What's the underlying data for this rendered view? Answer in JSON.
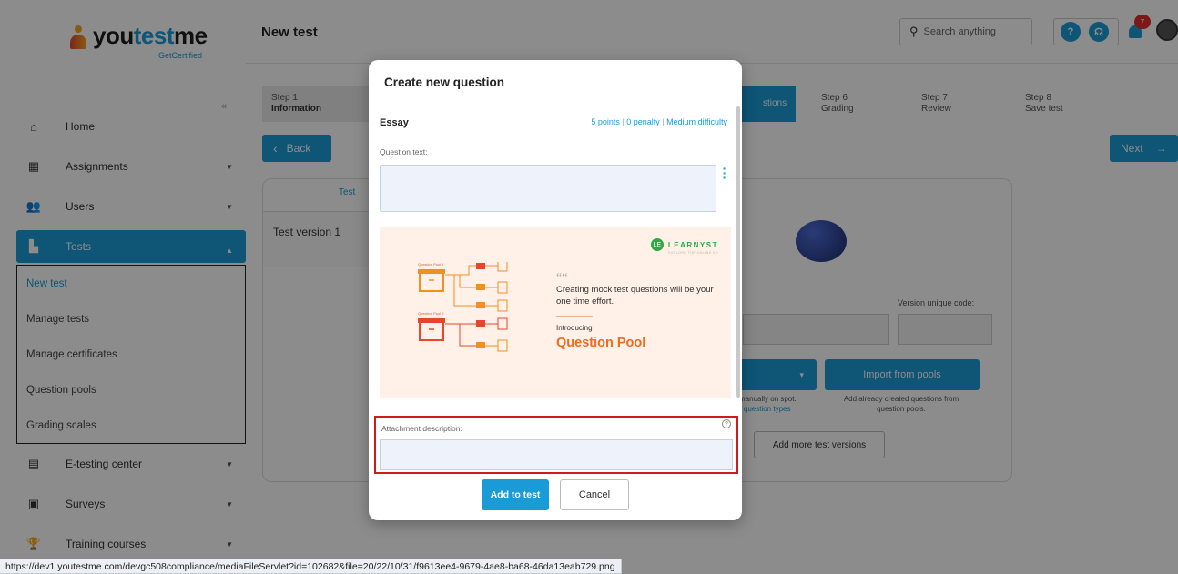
{
  "brand": {
    "name_part1": "you",
    "name_part2": "test",
    "name_part3": "me",
    "tagline": "GetCertified"
  },
  "header": {
    "page_title": "New test",
    "search_placeholder": "Search anything",
    "notifications_count": "7"
  },
  "sidebar": {
    "collapse_icon": "double-chevron-left-icon",
    "items": [
      {
        "label": "Home",
        "icon": "home-icon"
      },
      {
        "label": "Assignments",
        "icon": "assignments-icon"
      },
      {
        "label": "Users",
        "icon": "users-icon"
      },
      {
        "label": "Tests",
        "icon": "tests-icon"
      },
      {
        "label": "E-testing center",
        "icon": "calendar-icon"
      },
      {
        "label": "Surveys",
        "icon": "surveys-icon"
      },
      {
        "label": "Training courses",
        "icon": "trophy-icon"
      }
    ],
    "tests_subitems": [
      "New test",
      "Manage tests",
      "Manage certificates",
      "Question pools",
      "Grading scales"
    ]
  },
  "wizard": {
    "steps": [
      {
        "num": "Step 1",
        "label": "Information"
      },
      {
        "num": "Step 6",
        "label": "Grading"
      },
      {
        "num": "Step 7",
        "label": "Review"
      },
      {
        "num": "Step 8",
        "label": "Save test"
      }
    ],
    "active_step_fragment": "stions",
    "back_label": "Back",
    "next_label": "Next"
  },
  "background_card": {
    "tab_fragment": "Test",
    "version_label": "Test version 1",
    "version_code_label": "Version unique code:",
    "import_label": "Import from pools",
    "manual_help_line1": "manually on spot.",
    "manual_help_link": "r question types",
    "import_help": "Add already created questions from question pools.",
    "add_versions_label": "Add more test versions"
  },
  "modal": {
    "title": "Create new question",
    "question_type": "Essay",
    "points": "5 points",
    "penalty": "0 penalty",
    "difficulty": "Medium difficulty",
    "question_text_label": "Question text:",
    "question_text_value": "",
    "promo": {
      "logo_text": "LEARNYST",
      "logo_tagline": "EXPLORE THE ONLINE ED",
      "quote_mark": "““",
      "quote": "Creating mock test questions will be your one time effort.",
      "intro": "Introducing",
      "headline": "Question Pool",
      "pool_label_1": "Question Pool 1",
      "pool_label_2": "Question Pool 2"
    },
    "attachment_label": "Attachment description:",
    "attachment_value": "",
    "add_label": "Add to test",
    "cancel_label": "Cancel"
  },
  "status_url": "https://dev1.youtestme.com/devgc508compliance/mediaFileServlet?id=102682&file=20/22/10/31/f9613ee4-9679-4ae8-ba68-46da13eab729.png",
  "colors": {
    "accent": "#1a9bd7",
    "highlight_border": "#d11a1a",
    "promo_bg": "#fff0e8",
    "promo_orange": "#f06a1f"
  }
}
